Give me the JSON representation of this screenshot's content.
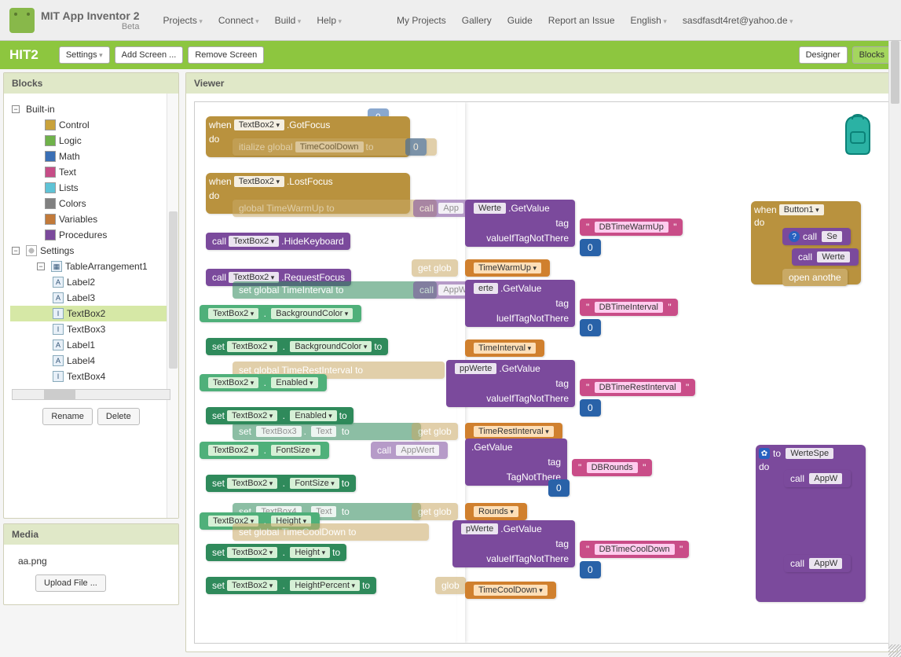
{
  "brand": {
    "title": "MIT App Inventor 2",
    "beta": "Beta"
  },
  "menu": {
    "projects": "Projects",
    "connect": "Connect",
    "build": "Build",
    "help": "Help",
    "myprojects": "My Projects",
    "gallery": "Gallery",
    "guide": "Guide",
    "report": "Report an Issue",
    "english": "English",
    "user": "sasdfasdt4ret@yahoo.de"
  },
  "ribbon": {
    "project": "HIT2",
    "settings": "Settings",
    "addscreen": "Add Screen ...",
    "removescreen": "Remove Screen",
    "designer": "Designer",
    "blocks": "Blocks"
  },
  "panels": {
    "blocks": "Blocks",
    "viewer": "Viewer",
    "media": "Media"
  },
  "builtins": {
    "header": "Built-in",
    "items": [
      {
        "label": "Control",
        "color": "#c9a23c"
      },
      {
        "label": "Logic",
        "color": "#6fb24a"
      },
      {
        "label": "Math",
        "color": "#3a6fb5"
      },
      {
        "label": "Text",
        "color": "#c64d87"
      },
      {
        "label": "Lists",
        "color": "#5fc3d6"
      },
      {
        "label": "Colors",
        "color": "#808080"
      },
      {
        "label": "Variables",
        "color": "#c27a3a"
      },
      {
        "label": "Procedures",
        "color": "#7b4a9c"
      }
    ]
  },
  "comps": {
    "settings": "Settings",
    "table": "TableArrangement1",
    "items": [
      "Label2",
      "Label3",
      "TextBox2",
      "TextBox3",
      "Label1",
      "Label4",
      "TextBox4"
    ],
    "selected": "TextBox2"
  },
  "buttons": {
    "rename": "Rename",
    "delete": "Delete",
    "upload": "Upload File ..."
  },
  "media": {
    "file": "aa.png"
  },
  "flyout": {
    "whenGot": {
      "when": "when",
      "comp": "TextBox2",
      "evt": ".GotFocus",
      "do": "do"
    },
    "whenLost": {
      "when": "when",
      "comp": "TextBox2",
      "evt": ".LostFocus",
      "do": "do"
    },
    "callHide": {
      "call": "call",
      "comp": "TextBox2",
      "m": ".HideKeyboard"
    },
    "callReq": {
      "call": "call",
      "comp": "TextBox2",
      "m": ".RequestFocus"
    },
    "getBg": {
      "comp": "TextBox2",
      "prop": "BackgroundColor"
    },
    "setBg": {
      "set": "set",
      "comp": "TextBox2",
      "prop": "BackgroundColor",
      "to": "to"
    },
    "getEn": {
      "comp": "TextBox2",
      "prop": "Enabled"
    },
    "setEn": {
      "set": "set",
      "comp": "TextBox2",
      "prop": "Enabled",
      "to": "to"
    },
    "getFs": {
      "comp": "TextBox2",
      "prop": "FontSize"
    },
    "setFs": {
      "set": "set",
      "comp": "TextBox2",
      "prop": "FontSize",
      "to": "to"
    },
    "getH": {
      "comp": "TextBox2",
      "prop": "Height"
    },
    "setH": {
      "set": "set",
      "comp": "TextBox2",
      "prop": "Height",
      "to": "to"
    },
    "setHp": {
      "set": "set",
      "comp": "TextBox2",
      "prop": "HeightPercent",
      "to": "to"
    }
  },
  "bg": {
    "g0": {
      "txt": "itialize global",
      "var": "TimeCoolDown",
      "to": "to",
      "val": "0"
    },
    "g1": {
      "txt": "global TimeWarmUp",
      "to": "to",
      "call": "call",
      "app": "App"
    },
    "g2": {
      "set": "set",
      "txt": "global TimeInterval",
      "to": "to",
      "call": "call",
      "app": "AppW"
    },
    "g3": {
      "set": "set",
      "txt": "global TimeRestInterval",
      "to": "to",
      "call": "call"
    },
    "g4": {
      "set": "set",
      "comp": "TextBox3",
      "prop": "Text",
      "to": "to",
      "get": "get",
      "glob": "glob"
    },
    "g5": {
      "set": "set",
      "comp": "TextBox4",
      "prop": "Text",
      "to": "to",
      "get": "get",
      "glob": "glob"
    },
    "g6": {
      "set": "set",
      "txt": "global TimeCoolDown",
      "to": "to",
      "call": "call"
    },
    "werte": "Werte",
    "getvalue": ".GetValue",
    "tag": "tag",
    "vint": "valueIfTagNotThere",
    "appwerte": "AppWerte",
    "ppwerte": "ppWerte",
    "tags": {
      "t1": "DBTimeWarmUp",
      "v1": "TimeWarmUp",
      "t2": "DBTimeInterval",
      "v2": "TimeInterval",
      "t3": "DBTimeRestInterval",
      "v3": "TimeRestInterval",
      "t4": "DBRounds",
      "v4": "Rounds",
      "t5": "DBTimeCoolDown",
      "v5": "TimeCoolDown"
    },
    "zero": "0",
    "whenBtn": {
      "when": "when",
      "comp": "Button1",
      "do": "do",
      "call": "call",
      "se": "Se",
      "werte": "Werte",
      "open": "open anothe"
    },
    "proc": {
      "to": "to",
      "name": "WerteSpe",
      "do": "do",
      "call": "call",
      "app": "AppW"
    }
  }
}
